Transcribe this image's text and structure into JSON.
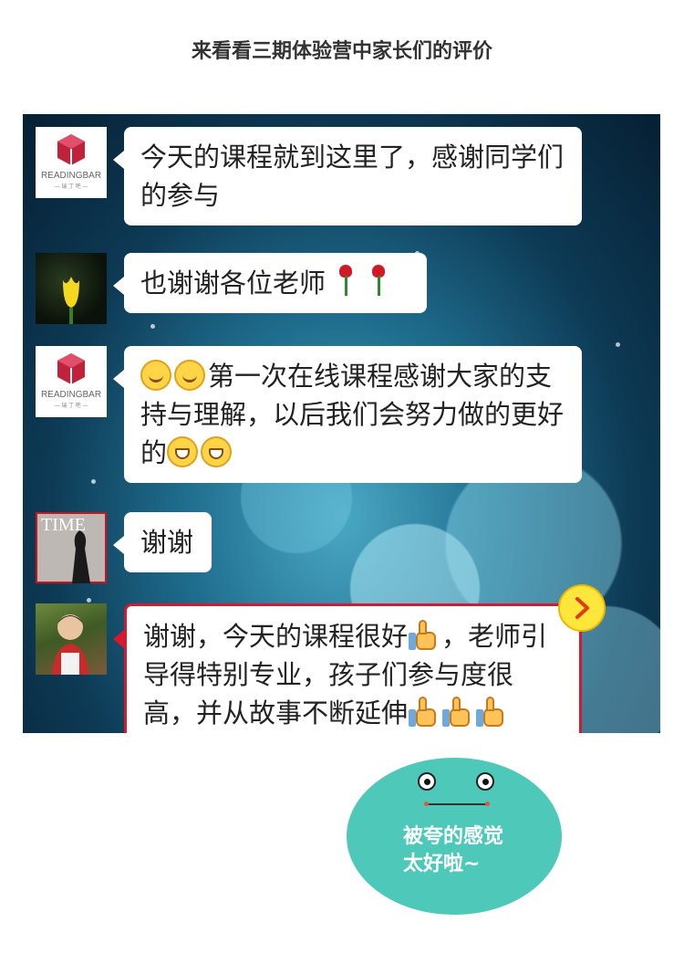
{
  "page": {
    "title": "来看看三期体验营中家长们的评价"
  },
  "chat": {
    "messages": [
      {
        "avatar": "readingbar-logo",
        "avatar_text": "READINGBAR",
        "avatar_subtext": "— 瑞 丁 吧 —",
        "text": "今天的课程就到这里了，感谢同学们的参与"
      },
      {
        "avatar": "yellow-tulip",
        "text": "也谢谢各位老师",
        "emoji_after": [
          "rose-icon",
          "rose-icon"
        ]
      },
      {
        "avatar": "readingbar-logo",
        "avatar_text": "READINGBAR",
        "avatar_subtext": "— 瑞 丁 吧 —",
        "emoji_before": [
          "smile-icon",
          "smile-icon"
        ],
        "text": "第一次在线课程感谢大家的支持与理解，以后我们会努力做的更好的",
        "emoji_after": [
          "grin-icon",
          "grin-icon"
        ]
      },
      {
        "avatar": "time-magazine-cover",
        "avatar_text": "TIME",
        "text": "谢谢"
      },
      {
        "avatar": "child-photo",
        "text_part1": "谢谢，今天的课程很好",
        "text_part2": "，老师引导得特别专业，孩子们参与度很高，并从故事不断延伸",
        "emoji_inline": [
          "thumbs-up-icon"
        ],
        "emoji_after": [
          "thumbs-up-icon",
          "thumbs-up-icon",
          "thumbs-up-icon"
        ],
        "highlighted": true
      }
    ],
    "next_button_icon": "chevron-right-icon"
  },
  "mascot": {
    "text": "被夸的感觉\n太好啦~"
  },
  "colors": {
    "highlight": "#d6192f",
    "mascot": "#4ec9b9",
    "next_button": "#ffe63b"
  }
}
